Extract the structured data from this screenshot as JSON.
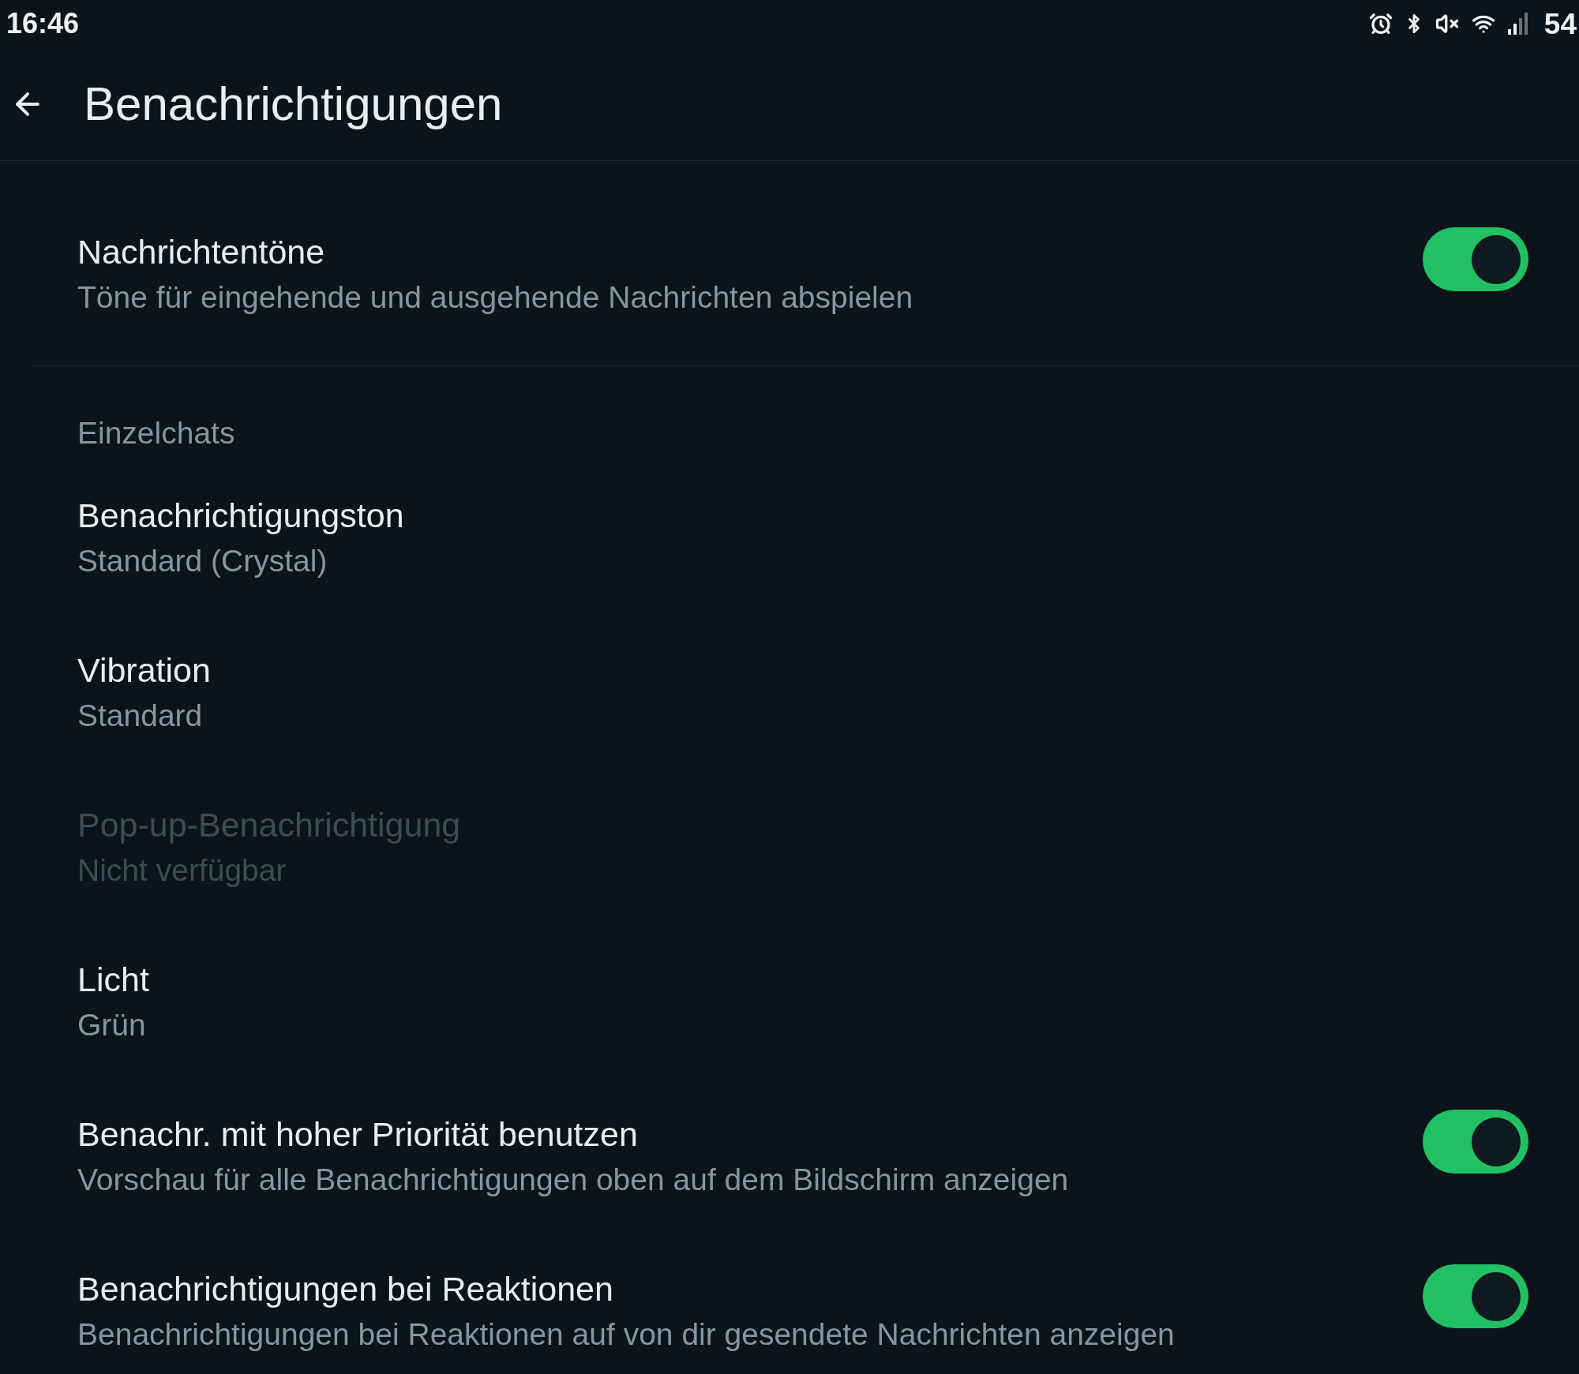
{
  "status_bar": {
    "time": "16:46",
    "battery": "54"
  },
  "header": {
    "title": "Benachrichtigungen"
  },
  "general": [
    {
      "kind": "toggle",
      "title": "Nachrichtentöne",
      "subtitle": "Töne für eingehende und ausgehende Nachrichten abspielen",
      "on": true
    }
  ],
  "sections": [
    {
      "heading": "Einzelchats",
      "items": [
        {
          "kind": "option",
          "title": "Benachrichtigungston",
          "value": "Standard (Crystal)",
          "disabled": false
        },
        {
          "kind": "option",
          "title": "Vibration",
          "value": "Standard",
          "disabled": false
        },
        {
          "kind": "option",
          "title": "Pop-up-Benachrichtigung",
          "value": "Nicht verfügbar",
          "disabled": true
        },
        {
          "kind": "option",
          "title": "Licht",
          "value": "Grün",
          "disabled": false
        },
        {
          "kind": "toggle",
          "title": "Benachr. mit hoher Priorität benutzen",
          "subtitle": "Vorschau für alle Benachrichtigungen oben auf dem Bildschirm anzeigen",
          "on": true,
          "disabled": false
        },
        {
          "kind": "toggle",
          "title": "Benachrichtigungen bei Reaktionen",
          "subtitle": "Benachrichtigungen bei Reaktionen auf von dir gesendete Nachrichten anzeigen",
          "on": true,
          "disabled": false
        }
      ]
    }
  ]
}
